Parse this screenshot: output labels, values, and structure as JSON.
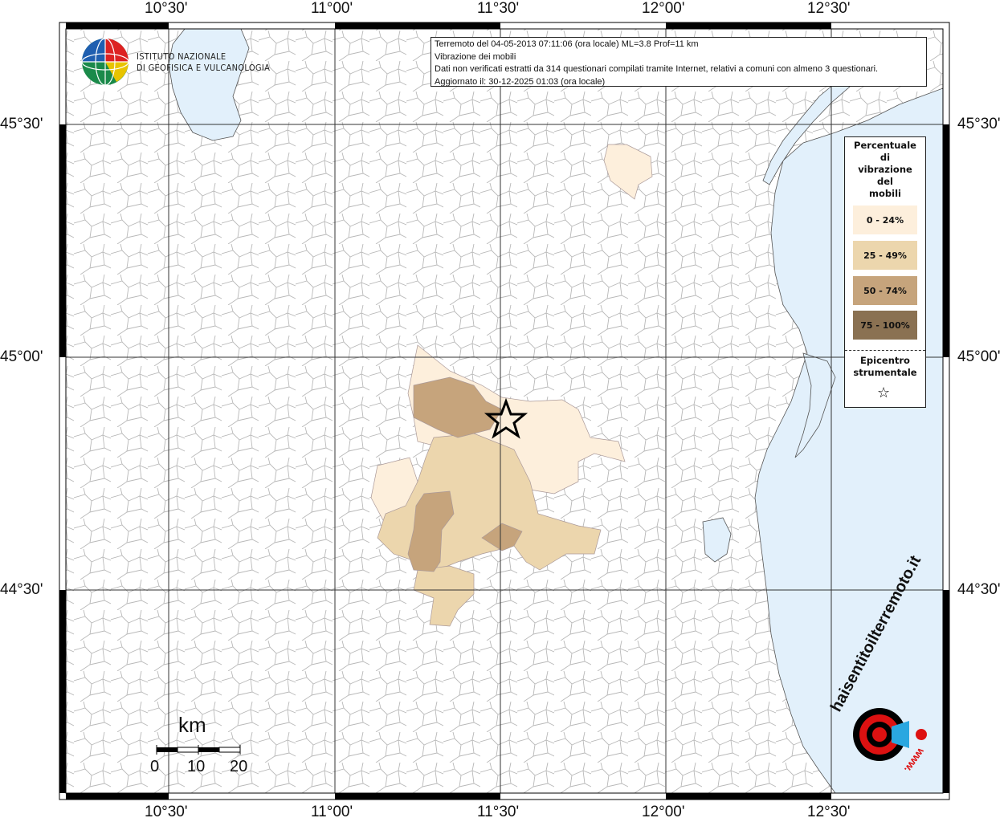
{
  "header": {
    "line1": "Terremoto del 04-05-2013 07:11:06 (ora locale) ML=3.8 Prof=11 km",
    "line2": "Vibrazione dei mobili",
    "line3": "Dati non verificati estratti da 314 questionari compilati tramite Internet, relativi a comuni con almeno 3 questionari.",
    "line4": "Aggiornato il: 30-12-2025 01:03 (ora locale)"
  },
  "institute": {
    "line1": "ISTITUTO NAZIONALE",
    "line2": "DI GEOFISICA E VULCANOLOGIA"
  },
  "axes": {
    "lon_labels": [
      "10°30'",
      "11°00'",
      "11°30'",
      "12°00'",
      "12°30'"
    ],
    "lat_labels": [
      "45°30'",
      "45°00'",
      "44°30'"
    ]
  },
  "legend": {
    "title": "Percentuale\ndi\nvibrazione\ndel\nmobili",
    "classes": [
      {
        "label": "0 - 24%",
        "color": "#fdefdc"
      },
      {
        "label": "25 - 49%",
        "color": "#ecd6ad"
      },
      {
        "label": "50 - 74%",
        "color": "#c6a47c"
      },
      {
        "label": "75 - 100%",
        "color": "#8a7152"
      }
    ],
    "epicenter_label": "Epicentro\nstrumentale",
    "epicenter_symbol": "☆"
  },
  "scale": {
    "unit": "km",
    "labels": [
      "0",
      "10",
      "20"
    ]
  },
  "colors": {
    "sea": "#e2f0fb",
    "boundary": "#b4b4b4",
    "grid": "#333333"
  },
  "logo": {
    "text": "haisentitoilterremoto.it",
    "sub": "www."
  }
}
